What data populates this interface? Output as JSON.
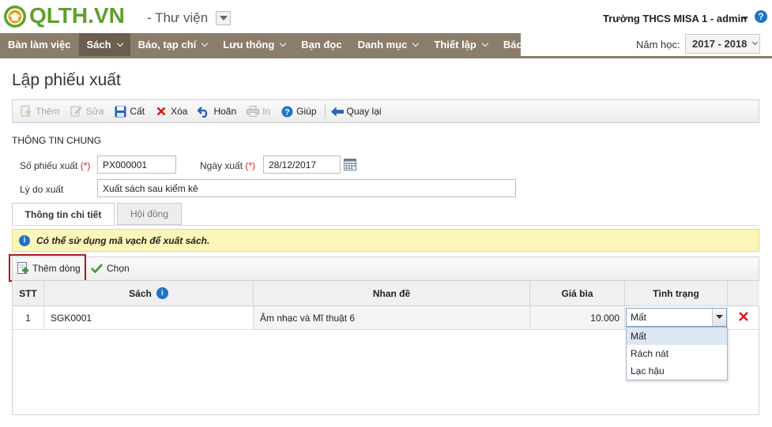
{
  "header": {
    "logo_text": "QLTH.VN",
    "module": "- Thư viện",
    "user": "Trường THCS MISA 1 - admin",
    "help": "?"
  },
  "nav": {
    "items": [
      {
        "label": "Bàn làm việc",
        "dropdown": false,
        "active": false
      },
      {
        "label": "Sách",
        "dropdown": true,
        "active": true
      },
      {
        "label": "Báo, tạp chí",
        "dropdown": true,
        "active": false
      },
      {
        "label": "Lưu thông",
        "dropdown": true,
        "active": false
      },
      {
        "label": "Bạn đọc",
        "dropdown": false,
        "active": false
      },
      {
        "label": "Danh mục",
        "dropdown": true,
        "active": false
      },
      {
        "label": "Thiết lập",
        "dropdown": true,
        "active": false
      },
      {
        "label": "Báo cáo",
        "dropdown": false,
        "active": false
      }
    ],
    "year_label": "Năm học:",
    "year_value": "2017 - 2018"
  },
  "page": {
    "title": "Lập phiếu xuất"
  },
  "toolbar": {
    "add": "Thêm",
    "edit": "Sửa",
    "save": "Cất",
    "delete": "Xóa",
    "undo": "Hoãn",
    "print": "In",
    "help": "Giúp",
    "back": "Quay lại"
  },
  "form": {
    "section": "THÔNG TIN CHUNG",
    "doc_no_label": "Số phiếu xuất",
    "doc_no_value": "PX000001",
    "date_label": "Ngày xuất",
    "date_value": "28/12/2017",
    "reason_label": "Lý do xuất",
    "reason_value": "Xuất sách sau kiểm kê",
    "required_mark": "(*)"
  },
  "tabs": {
    "detail": "Thông tin chi tiết",
    "council": "Hội đồng"
  },
  "notice": {
    "text": "Có thể sử dụng mã vạch để xuất sách."
  },
  "grid": {
    "add_row": "Thêm dòng",
    "choose": "Chọn",
    "columns": {
      "stt": "STT",
      "book": "Sách",
      "title": "Nhan đề",
      "price": "Giá bìa",
      "status": "Tình trạng"
    },
    "rows": [
      {
        "stt": "1",
        "book": "SGK0001",
        "title": "Âm nhạc và Mĩ thuật 6",
        "price": "10.000",
        "status": "Mất"
      }
    ],
    "status_options": [
      "Mất",
      "Rách nát",
      "Lạc hậu"
    ]
  },
  "colors": {
    "brand": "#5da02d",
    "nav": "#8b7d6b",
    "nav_active": "#6b5e4e",
    "notice_bg": "#fdf6b9",
    "highlight_border": "#b01818"
  }
}
